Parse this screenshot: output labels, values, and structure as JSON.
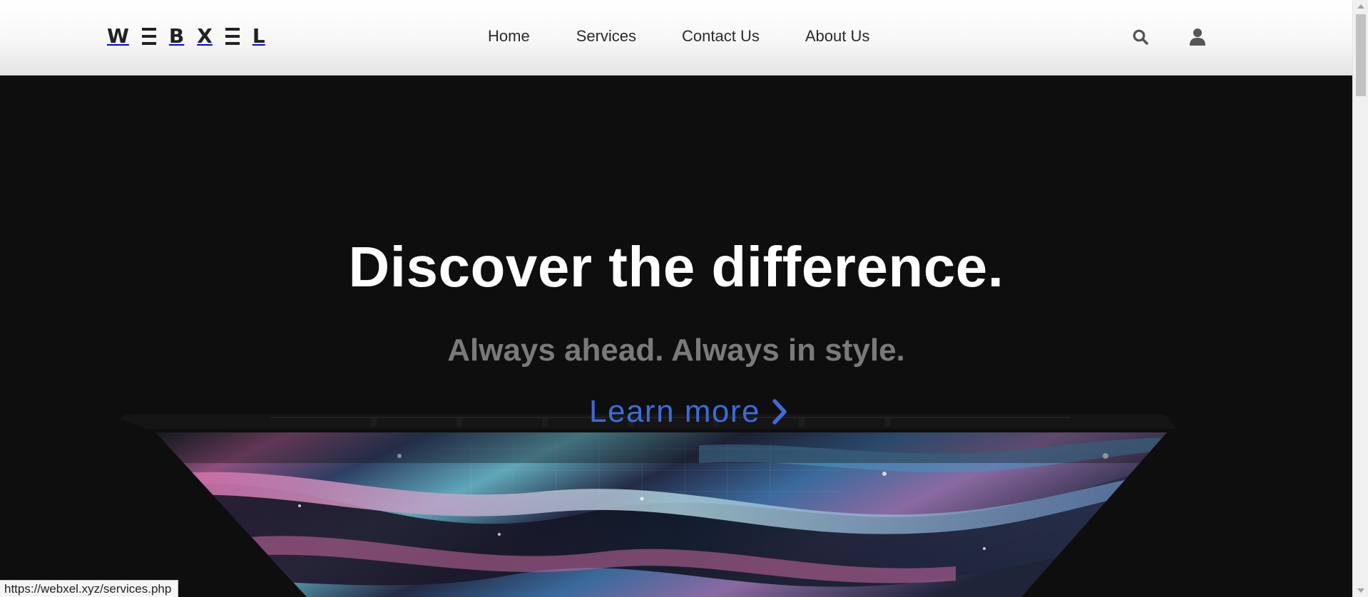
{
  "brand": {
    "logo_letters": [
      "W",
      "B",
      "X",
      "L"
    ],
    "logo_alt_text": "WEBXEL"
  },
  "nav": {
    "home": "Home",
    "services": "Services",
    "contact": "Contact Us",
    "about": "About Us"
  },
  "icons": {
    "search": "search-icon",
    "user": "user-icon",
    "learn_more": "chevron-right-icon"
  },
  "hero": {
    "title": "Discover the difference.",
    "subtitle": "Always ahead. Always in style.",
    "cta": "Learn more"
  },
  "status_bar": {
    "url": "https://webxel.xyz/services.php"
  },
  "colors": {
    "hero_bg": "#0e0e0f",
    "accent": "#3f6bd6",
    "subtitle": "#7a7a7b"
  }
}
